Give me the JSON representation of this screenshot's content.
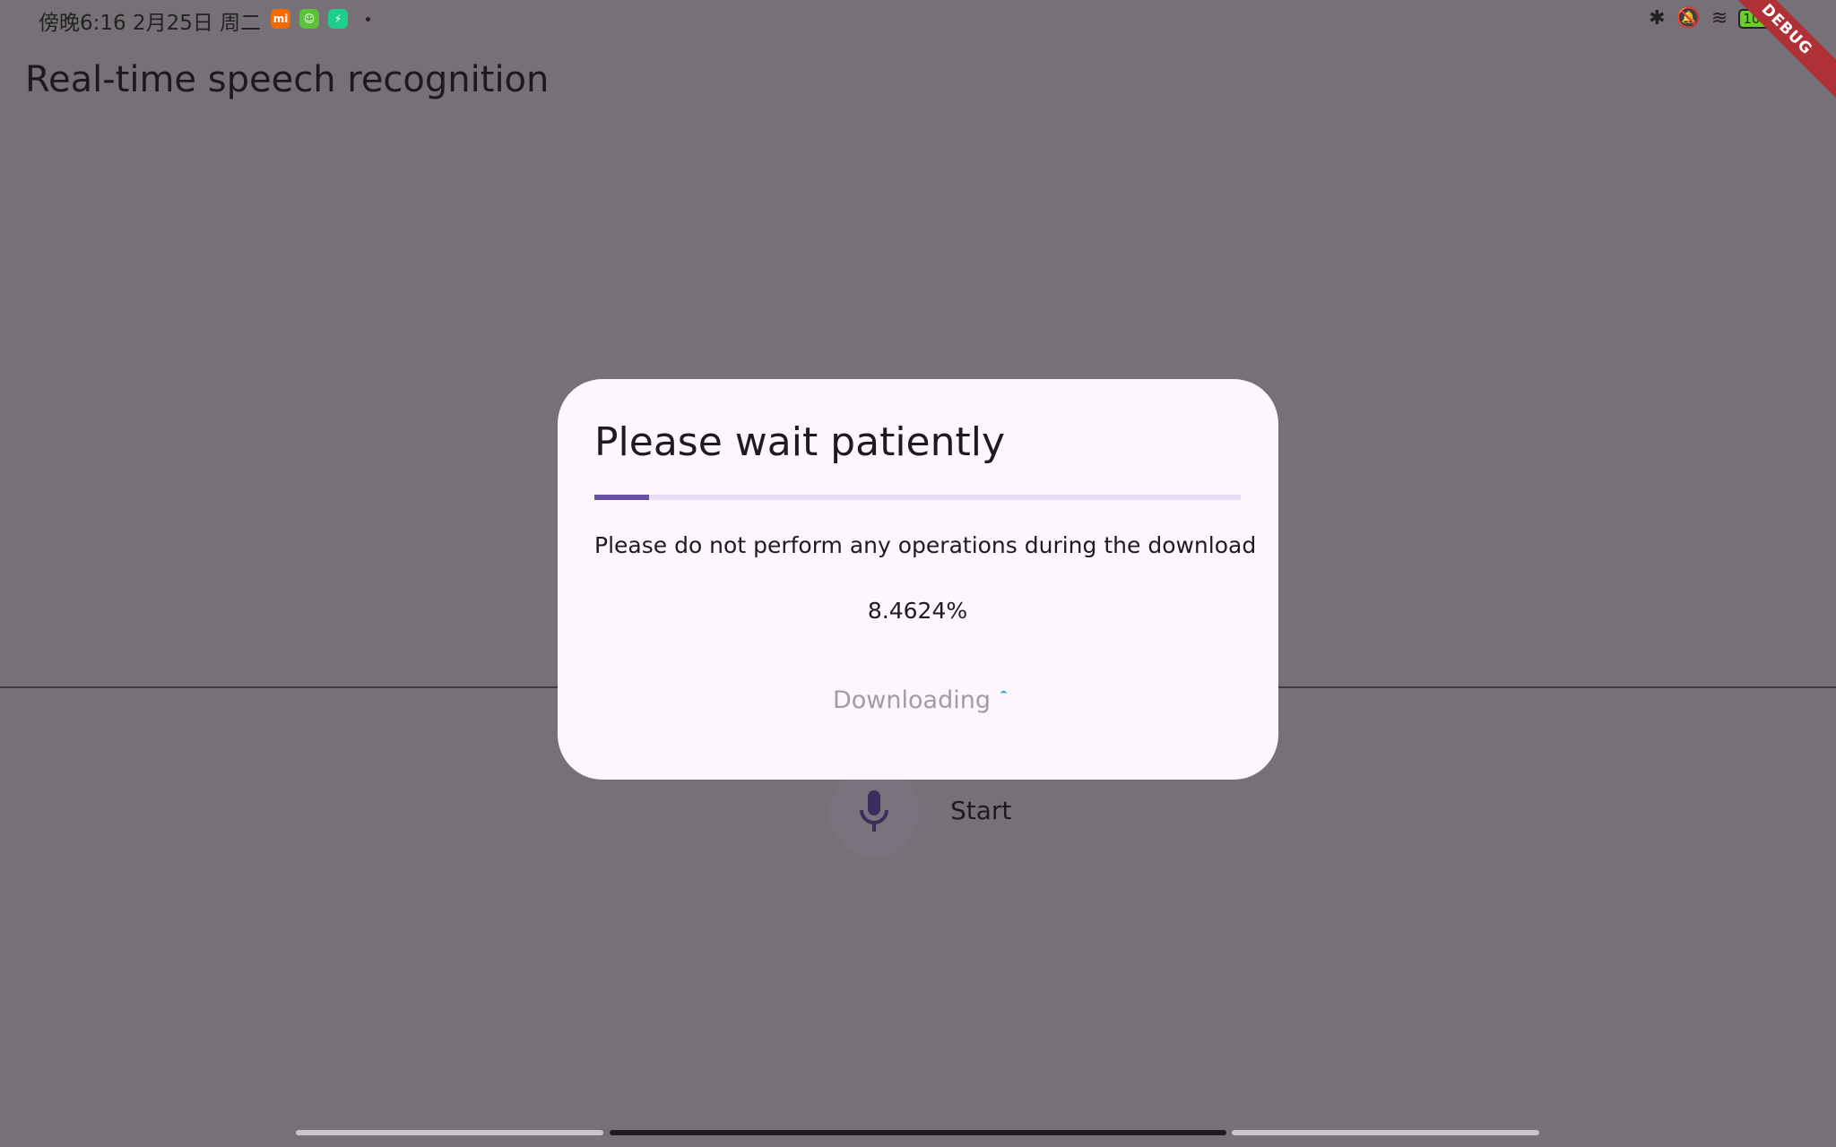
{
  "status_bar": {
    "time_date": "傍晚6:16 2月25日 周二",
    "app_icons": [
      {
        "name": "mi-icon",
        "label": "mi",
        "color": "#f56a00"
      },
      {
        "name": "android-app-icon",
        "label": "☺",
        "color": "#5cc23a"
      },
      {
        "name": "security-shield-icon",
        "label": "⚡",
        "color": "#1ccf8a"
      }
    ],
    "battery": "100",
    "debug_banner": "DEBUG"
  },
  "app": {
    "title": "Real-time speech recognition",
    "start_label": "Start"
  },
  "dialog": {
    "title": "Please wait patiently",
    "progress_percent": 8.4624,
    "message": "Please do not perform any operations during the download",
    "percent_text": "8.4624%",
    "button_label": "Downloading"
  },
  "colors": {
    "accent": "#6750a4",
    "track": "#e8def8",
    "dialog_bg": "#fdf7fd",
    "scrim_bg": "#767176"
  }
}
